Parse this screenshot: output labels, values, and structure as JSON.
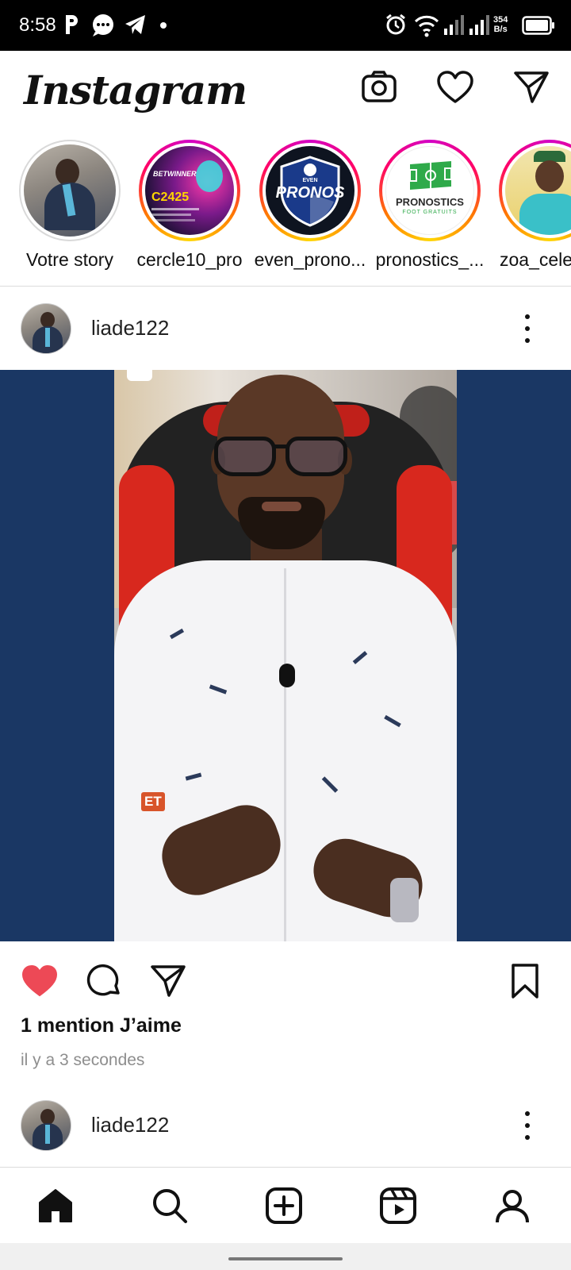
{
  "status_bar": {
    "time": "8:58",
    "speed_value": "354",
    "speed_unit": "B/s",
    "icons": [
      "p-icon",
      "message-bubble-icon",
      "telegram-icon",
      "dot-icon",
      "alarm-icon",
      "wifi-icon",
      "signal-icon",
      "signal-icon",
      "battery-icon"
    ]
  },
  "header": {
    "logo": "Instagram",
    "icons": [
      "camera-icon",
      "heart-icon",
      "send-icon"
    ]
  },
  "stories": [
    {
      "label": "Votre story",
      "ring": "seen"
    },
    {
      "label": "cercle10_pro",
      "ring": "gradient",
      "badge_text": "C2425",
      "badge_top": "BETWINNER"
    },
    {
      "label": "even_prono...",
      "ring": "gradient",
      "logo_text": "PRONOS",
      "logo_top": "EVEN"
    },
    {
      "label": "pronostics_...",
      "ring": "gradient",
      "logo_text": "PRONOSTICS",
      "logo_sub": "FOOT GRATUITS"
    },
    {
      "label": "zoa_cele",
      "ring": "gradient"
    }
  ],
  "posts": [
    {
      "username": "liade122",
      "liked": true,
      "likes_text": "1 mention J’aime",
      "time_text": "il y a 3 secondes",
      "overlay_text": "ET"
    },
    {
      "username": "liade122"
    }
  ],
  "nav": {
    "items": [
      "home-icon",
      "search-icon",
      "add-post-icon",
      "reels-icon",
      "profile-icon"
    ],
    "active": "home-icon"
  },
  "colors": {
    "like_red": "#ed4956",
    "media_bg": "#1a3764",
    "muted_text": "#8e8e8e"
  }
}
